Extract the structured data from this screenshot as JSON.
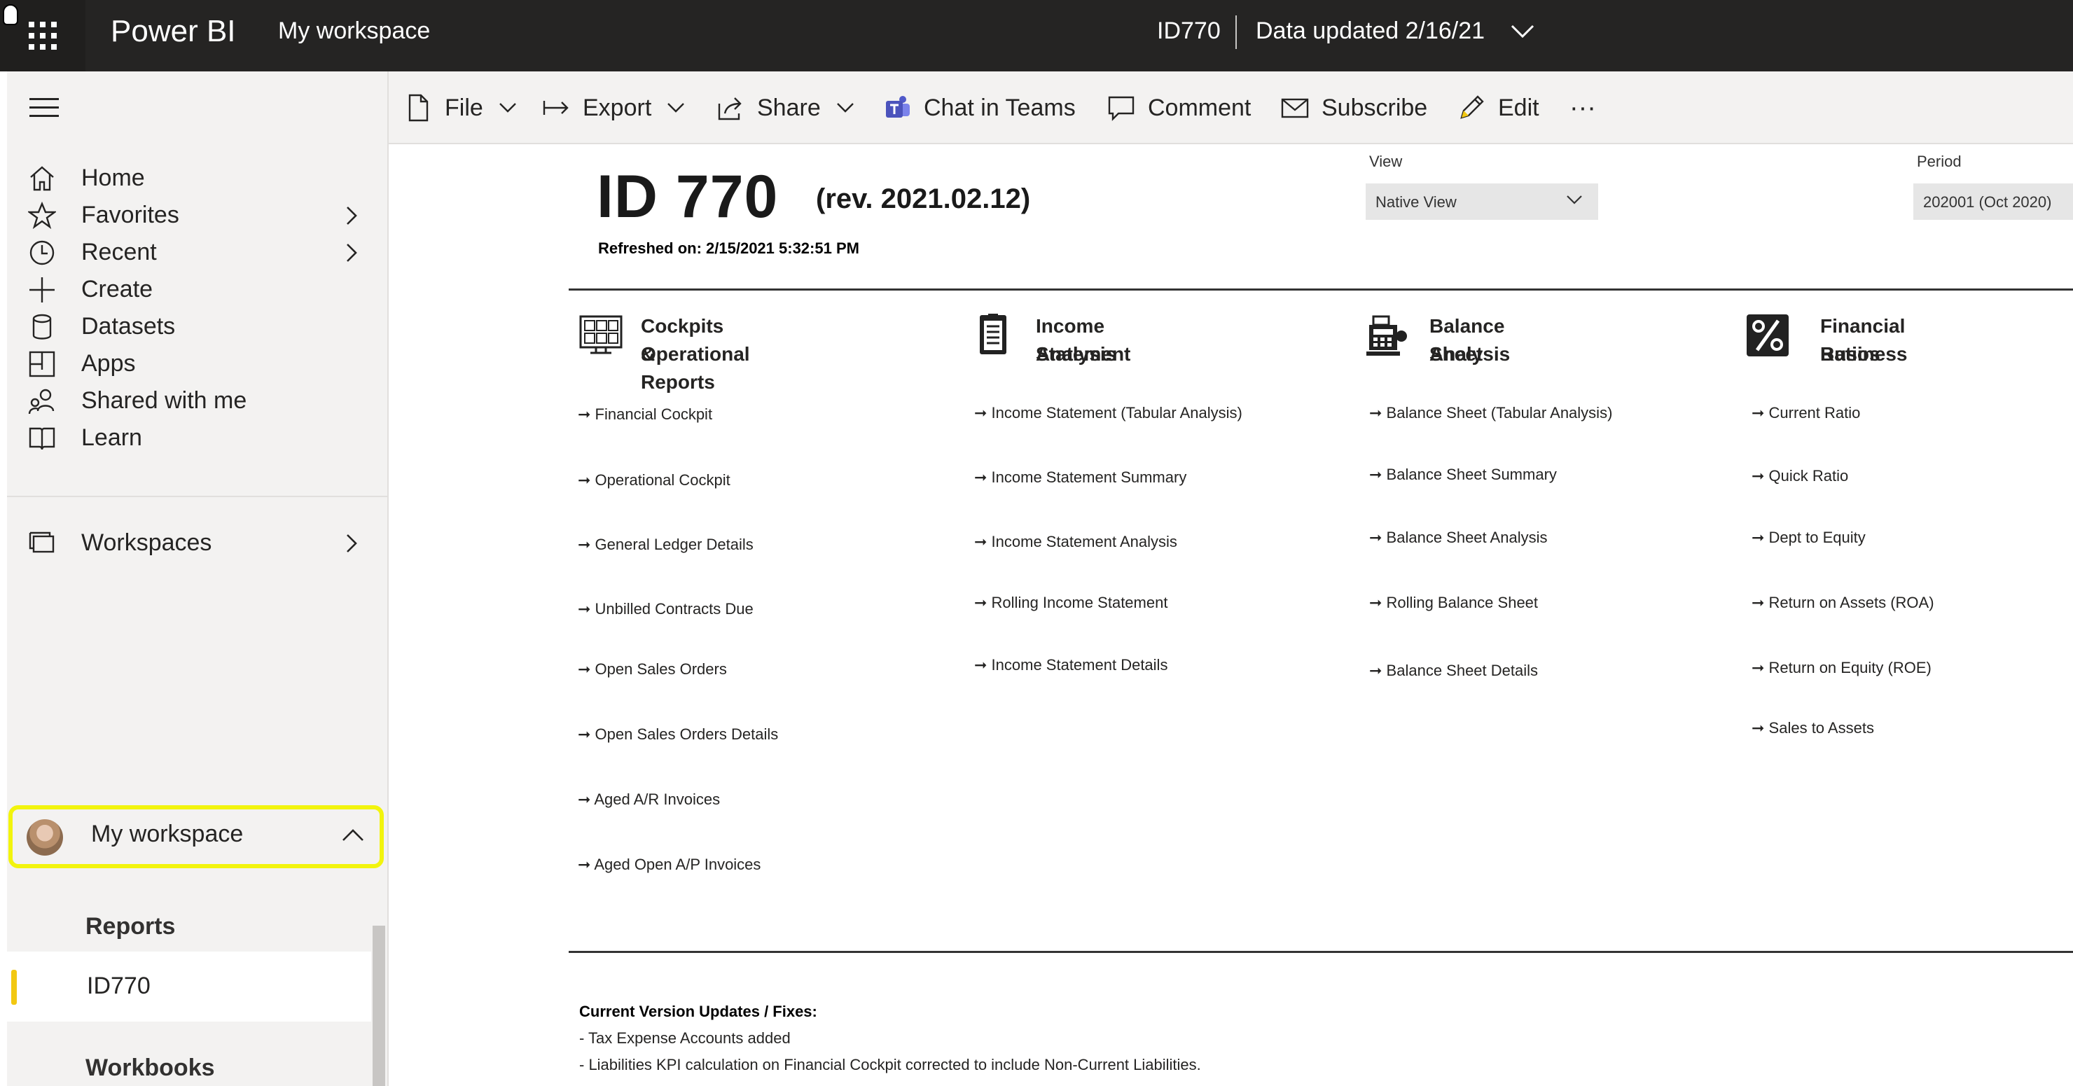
{
  "topbar": {
    "brand": "Power BI",
    "workspace": "My workspace",
    "report_id": "ID770",
    "data_updated": "Data updated 2/16/21"
  },
  "leftnav": {
    "items": [
      {
        "label": "Home",
        "icon": "home-icon"
      },
      {
        "label": "Favorites",
        "icon": "star-icon"
      },
      {
        "label": "Recent",
        "icon": "clock-icon"
      },
      {
        "label": "Create",
        "icon": "plus-icon"
      },
      {
        "label": "Datasets",
        "icon": "database-icon"
      },
      {
        "label": "Apps",
        "icon": "apps-icon"
      },
      {
        "label": "Shared with me",
        "icon": "shared-icon"
      },
      {
        "label": "Learn",
        "icon": "book-icon"
      }
    ],
    "workspaces": "Workspaces",
    "my_workspace": "My workspace",
    "reports_label": "Reports",
    "selected_report": "ID770",
    "workbooks_label": "Workbooks",
    "highlight_color": "#f2f40d",
    "selected_accent": "#f2c811"
  },
  "actionbar": {
    "file": "File",
    "export": "Export",
    "share": "Share",
    "chat": "Chat in Teams",
    "comment": "Comment",
    "subscribe": "Subscribe",
    "edit": "Edit",
    "more": "···"
  },
  "report": {
    "title": "ID 770",
    "revision": "(rev. 2021.02.12)",
    "refreshed": "Refreshed on: 2/15/2021 5:32:51 PM",
    "view_label": "View",
    "view_value": "Native View",
    "period_label": "Period",
    "period_value": "202001 (Oct 2020)",
    "columns": [
      {
        "title_line1": "Cockpits &",
        "title_line2": "Operational Reports",
        "links": [
          "➞ Financial Cockpit",
          "➞ Operational Cockpit",
          "➞ General Ledger Details",
          "➞ Unbilled Contracts Due",
          "➞ Open Sales Orders",
          "➞ Open Sales Orders Details",
          "➞ Aged A/R Invoices",
          "➞ Aged Open A/P Invoices"
        ]
      },
      {
        "title_line1": "Income Statement",
        "title_line2": "Analysis",
        "links": [
          "➞ Income Statement (Tabular Analysis)",
          "➞ Income Statement Summary",
          "➞ Income Statement Analysis",
          "➞ Rolling Income Statement",
          "➞ Income Statement Details"
        ]
      },
      {
        "title_line1": "Balance Sheet",
        "title_line2": "Analysis",
        "links": [
          "➞ Balance Sheet (Tabular Analysis)",
          "➞ Balance Sheet Summary",
          "➞ Balance Sheet Analysis",
          "➞ Rolling Balance Sheet",
          "➞ Balance Sheet Details"
        ]
      },
      {
        "title_line1": "Financial Business",
        "title_line2": "Ratios",
        "links": [
          "➞ Current Ratio",
          "➞ Quick Ratio",
          "➞ Dept to Equity",
          "➞ Return on Assets (ROA)",
          "➞ Return on Equity (ROE)",
          "➞ Sales to Assets"
        ]
      }
    ],
    "updates_title": "Current Version Updates / Fixes:",
    "updates": [
      "- Tax Expense Accounts added",
      "- Liabilities KPI calculation on Financial Cockpit corrected to include Non-Current Liabilities."
    ]
  }
}
